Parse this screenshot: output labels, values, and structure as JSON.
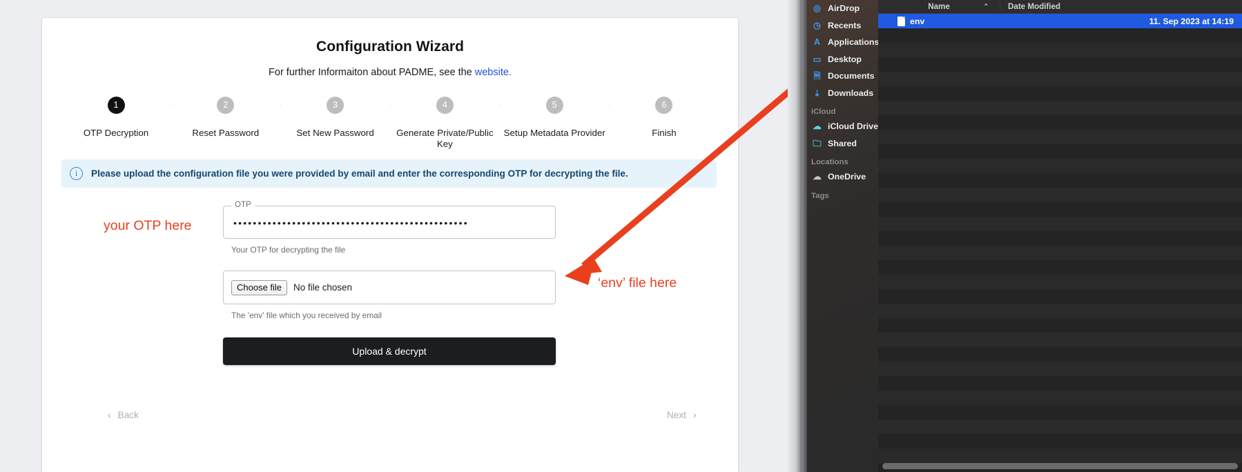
{
  "wizard": {
    "title": "Configuration Wizard",
    "subtitle_prefix": "For further Informaiton about PADME, see the ",
    "link_label": "website.",
    "steps": [
      {
        "number": "1",
        "label": "OTP Decryption",
        "active": true
      },
      {
        "number": "2",
        "label": "Reset Password",
        "active": false
      },
      {
        "number": "3",
        "label": "Set New Password",
        "active": false
      },
      {
        "number": "4",
        "label": "Generate Private/Public Key",
        "active": false
      },
      {
        "number": "5",
        "label": "Setup Metadata Provider",
        "active": false
      },
      {
        "number": "6",
        "label": "Finish",
        "active": false
      }
    ],
    "alert": {
      "icon": "info-icon",
      "text": "Please upload the configuration file you were provided by email and enter the corresponding OTP for decrypting the file."
    },
    "form": {
      "otp_legend": "OTP",
      "otp_value": "••••••••••••••••••••••••••••••••••••••••••••••••",
      "otp_helper": "Your OTP for decrypting the file",
      "file_button_label": "Choose file",
      "file_status": "No file chosen",
      "file_helper": "The 'env' file which you received by email",
      "submit_label": "Upload & decrypt"
    },
    "footer": {
      "back_label": "Back",
      "back_chevron": "‹",
      "next_label": "Next",
      "next_chevron": "›"
    }
  },
  "annotations": {
    "otp_note": "your OTP here",
    "env_note": "‘env’ file here",
    "arrow_color": "#e8401f"
  },
  "finder": {
    "sidebar": {
      "favorites": [
        {
          "label": "AirDrop",
          "icon": "airdrop-icon",
          "glyph": "◎"
        },
        {
          "label": "Recents",
          "icon": "clock-icon",
          "glyph": "◷"
        },
        {
          "label": "Applications",
          "icon": "applications-icon",
          "glyph": "A"
        },
        {
          "label": "Desktop",
          "icon": "desktop-icon",
          "glyph": "▭"
        },
        {
          "label": "Documents",
          "icon": "document-icon",
          "glyph": "🗎"
        },
        {
          "label": "Downloads",
          "icon": "downloads-icon",
          "glyph": "⤓"
        }
      ],
      "icloud_header": "iCloud",
      "icloud": [
        {
          "label": "iCloud Drive",
          "icon": "cloud-icon",
          "glyph": "☁"
        },
        {
          "label": "Shared",
          "icon": "shared-folder-icon",
          "glyph": "🗀"
        }
      ],
      "locations_header": "Locations",
      "locations": [
        {
          "label": "OneDrive",
          "icon": "cloud-icon",
          "glyph": "☁"
        }
      ],
      "tags_header": "Tags"
    },
    "columns": {
      "name": "Name",
      "sort_caret": "⌃",
      "date_modified": "Date Modified"
    },
    "files": [
      {
        "name": "env",
        "date_modified": "11. Sep 2023 at 14:19",
        "selected": true,
        "icon": "file-icon"
      }
    ]
  }
}
